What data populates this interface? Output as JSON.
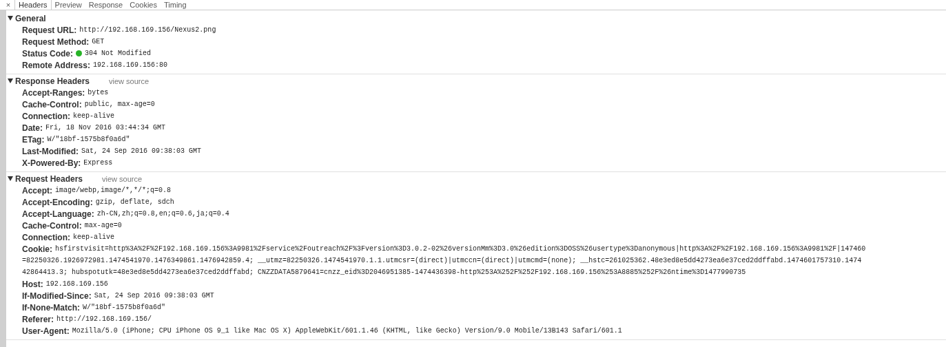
{
  "tabs": [
    {
      "label": "×",
      "kind": "close",
      "selected": false
    },
    {
      "label": "Headers",
      "kind": "tab",
      "selected": true
    },
    {
      "label": "Preview",
      "kind": "tab",
      "selected": false
    },
    {
      "label": "Response",
      "kind": "tab",
      "selected": false
    },
    {
      "label": "Cookies",
      "kind": "tab",
      "selected": false
    },
    {
      "label": "Timing",
      "kind": "tab",
      "selected": false
    }
  ],
  "sections": [
    {
      "title": "General",
      "expanded": true,
      "items": [
        {
          "name": "Request URL:",
          "value_lines": [
            "http://192.168.169.156/Nexus2.png"
          ]
        },
        {
          "name": "Request Method:",
          "value_lines": [
            "GET"
          ]
        },
        {
          "name": "Status Code:",
          "color": "#27b327",
          "value_lines": [
            "304 Not Modified"
          ]
        },
        {
          "name": "Remote Address:",
          "value_lines": [
            "192.168.169.156:80"
          ]
        }
      ]
    },
    {
      "title": "Response Headers",
      "link": "view source",
      "expanded": true,
      "items": [
        {
          "name": "Accept-Ranges:",
          "value_lines": [
            "bytes"
          ]
        },
        {
          "name": "Cache-Control:",
          "value_lines": [
            "public, max-age=0"
          ]
        },
        {
          "name": "Connection:",
          "value_lines": [
            "keep-alive"
          ]
        },
        {
          "name": "Date:",
          "value_lines": [
            "Fri, 18 Nov 2016 03:44:34 GMT"
          ]
        },
        {
          "name": "ETag:",
          "value_lines": [
            "W/\"18bf-1575b8f0a6d\""
          ]
        },
        {
          "name": "Last-Modified:",
          "value_lines": [
            "Sat, 24 Sep 2016 09:38:03 GMT"
          ]
        },
        {
          "name": "X-Powered-By:",
          "value_lines": [
            "Express"
          ]
        }
      ]
    },
    {
      "title": "Request Headers",
      "link": "view source",
      "expanded": true,
      "items": [
        {
          "name": "Accept:",
          "value_lines": [
            "image/webp,image/*,*/*;q=0.8"
          ]
        },
        {
          "name": "Accept-Encoding:",
          "value_lines": [
            "gzip, deflate, sdch"
          ]
        },
        {
          "name": "Accept-Language:",
          "value_lines": [
            "zh-CN,zh;q=0.8,en;q=0.6,ja;q=0.4"
          ]
        },
        {
          "name": "Cache-Control:",
          "value_lines": [
            "max-age=0"
          ]
        },
        {
          "name": "Connection:",
          "value_lines": [
            "keep-alive"
          ]
        },
        {
          "name": "Cookie:",
          "value_lines": [
            "hsfirstvisit=http%3A%2F%2F192.168.169.156%3A9981%2Fservice%2Foutreach%2F%3Fversion%3D3.0.2-02%26versionMm%3D3.0%26edition%3DOSS%26usertype%3Danonymous|http%3A%2F%2F192.168.169.156%3A9981%2F|147460",
            "=82250326.1926972981.1474541970.1476349861.1476942859.4; __utmz=82250326.1474541970.1.1.utmcsr=(direct)|utmccn=(direct)|utmcmd=(none); __hstc=261025362.48e3ed8e5dd4273ea6e37ced2ddffabd.1474601757310.1474",
            "42864413.3; hubspotutk=48e3ed8e5dd4273ea6e37ced2ddffabd; CNZZDATA5879641=cnzz_eid%3D2046951385-1474436398-http%253A%252F%252F192.168.169.156%253A8885%252F%26ntime%3D1477990735"
          ]
        },
        {
          "name": "Host:",
          "value_lines": [
            "192.168.169.156"
          ]
        },
        {
          "name": "If-Modified-Since:",
          "value_lines": [
            "Sat, 24 Sep 2016 09:38:03 GMT"
          ]
        },
        {
          "name": "If-None-Match:",
          "value_lines": [
            "W/\"18bf-1575b8f0a6d\""
          ]
        },
        {
          "name": "Referer:",
          "value_lines": [
            "http://192.168.169.156/"
          ]
        },
        {
          "name": "User-Agent:",
          "value_lines": [
            "Mozilla/5.0 (iPhone; CPU iPhone OS 9_1 like Mac OS X) AppleWebKit/601.1.46 (KHTML, like Gecko) Version/9.0 Mobile/13B143 Safari/601.1"
          ]
        }
      ]
    }
  ]
}
